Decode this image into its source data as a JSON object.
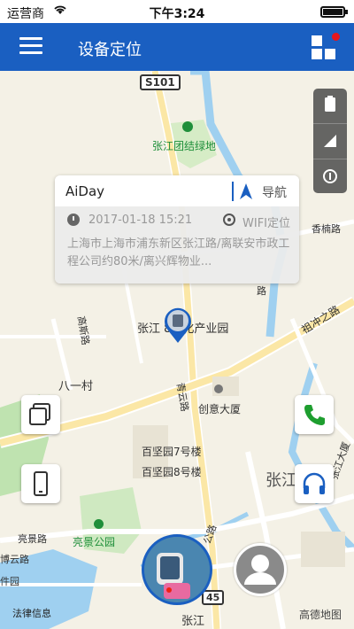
{
  "status_bar": {
    "carrier": "运营商",
    "time": "下午3:24"
  },
  "header": {
    "title": "设备定位"
  },
  "popup": {
    "device_name": "AiDay",
    "nav_label": "导航",
    "timestamp": "2017-01-18 15:21",
    "location_type": "WIFI定位",
    "address": "上海市上海市浦东新区张江路/离联安市政工程公司约80米/离兴辉物业..."
  },
  "map": {
    "labels": {
      "s101": "S101",
      "zhangjiang_green": "张江团结绿地",
      "xiangnan_rd": "香楠路",
      "zhangjiang_cultural": "张江   8文化产业园",
      "zuchongzhi_rd": "祖冲之路",
      "bayi_village": "八一村",
      "qingyun_rd": "青云路",
      "chuangyi_tower": "创意大厦",
      "gaosi_rd": "高斯路",
      "baijian_7": "百坚园7号楼",
      "baijian_8": "百坚园8号楼",
      "zhangjiang_big": "张江",
      "zhangjiang_tower": "张江大厦",
      "liangjing_rd": "亮景路",
      "liangjing_park": "亮景公园",
      "bo_yun_rd": "博云路",
      "jian_rd": "件园",
      "law_info": "法律信息",
      "gaode": "高德地图",
      "zhangjiang_bottom": "张江",
      "road_45": "45",
      "gong_rd": "公路",
      "lu_label": "路"
    }
  },
  "colors": {
    "primary": "#1a5fc1",
    "badge": "#e5161c",
    "phone_green": "#1e9e2f"
  }
}
